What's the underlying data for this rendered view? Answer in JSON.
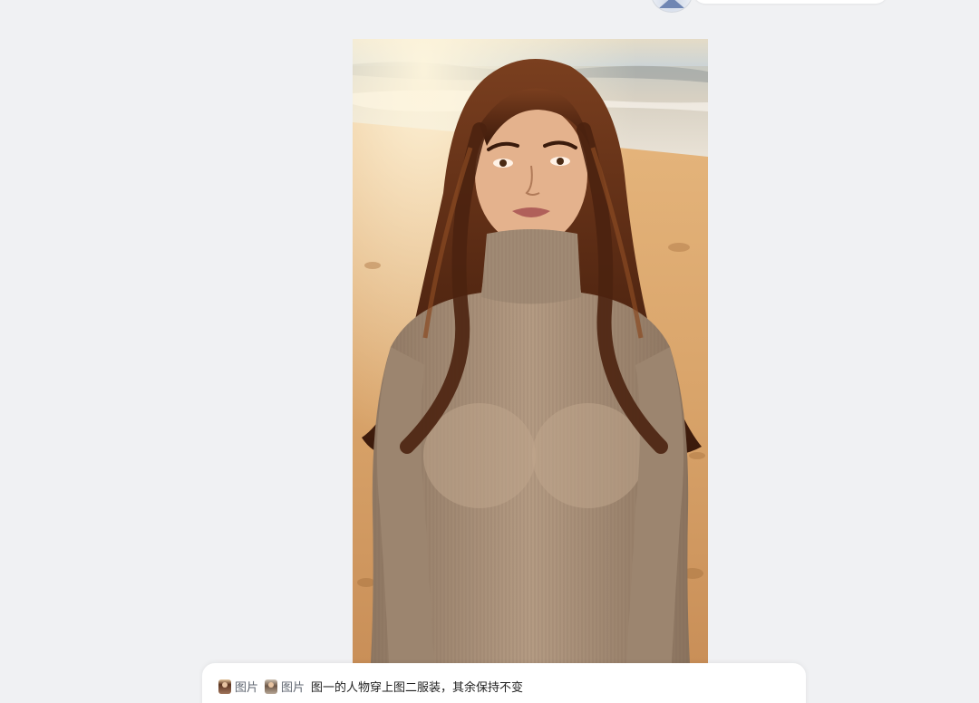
{
  "prompt": {
    "chips": [
      {
        "label": "图片"
      },
      {
        "label": "图片"
      }
    ],
    "text": "图一的人物穿上图二服装，其余保持不变"
  },
  "colors": {
    "background": "#f0f1f3",
    "prompt_bar": "#ffffff",
    "chip_text": "#5f6670"
  },
  "icons": {
    "chip_thumbnail_1": "person-thumbnail-icon",
    "chip_thumbnail_2": "clothing-thumbnail-icon",
    "top_avatar": "avatar-icon"
  }
}
